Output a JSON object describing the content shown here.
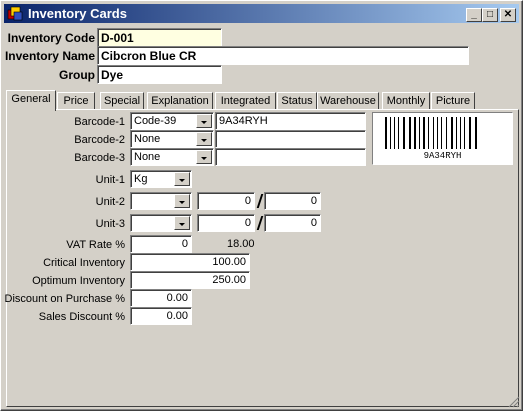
{
  "window": {
    "title": "Inventory Cards",
    "minimize_label": "_",
    "maximize_label": "□",
    "close_label": "✕"
  },
  "header": {
    "code_label": "Inventory Code",
    "code_value": "D-001",
    "name_label": "Inventory Name",
    "name_value": "Cibcron Blue CR",
    "group_label": "Group",
    "group_value": "Dye"
  },
  "tabs": [
    "General",
    "Price",
    "Special",
    "Explanation",
    "Integrated",
    "Status",
    "Warehouse",
    "Monthly",
    "Picture"
  ],
  "general": {
    "barcode1_label": "Barcode-1",
    "barcode1_type": "Code-39",
    "barcode1_value": "9A34RYH",
    "barcode2_label": "Barcode-2",
    "barcode2_type": "None",
    "barcode2_value": "",
    "barcode3_label": "Barcode-3",
    "barcode3_type": "None",
    "barcode3_value": "",
    "barcode_image_text": "9A34RYH",
    "unit1_label": "Unit-1",
    "unit1_value": "Kg",
    "unit2_label": "Unit-2",
    "unit2_value": "",
    "unit2_num": "0",
    "unit2_den": "0",
    "unit3_label": "Unit-3",
    "unit3_value": "",
    "unit3_num": "0",
    "unit3_den": "0",
    "vat_label": "VAT Rate %",
    "vat_value": "0",
    "vat_display": "18.00",
    "critical_label": "Critical Inventory",
    "critical_value": "100.00",
    "optimum_label": "Optimum Inventory",
    "optimum_value": "250.00",
    "discount_purchase_label": "Discount on Purchase %",
    "discount_purchase_value": "0.00",
    "sales_discount_label": "Sales Discount %",
    "sales_discount_value": "0.00"
  }
}
